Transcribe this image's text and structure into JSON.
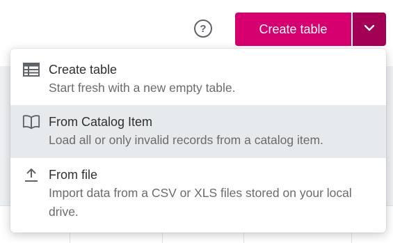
{
  "header": {
    "help_icon": "help-circle-icon",
    "create_button_label": "Create table",
    "caret_icon": "chevron-down-icon"
  },
  "colors": {
    "brand": "#d6006f",
    "brand_dark": "#a30055",
    "hover_bg": "#e6eaec"
  },
  "menu": {
    "items": [
      {
        "icon": "table-icon",
        "title": "Create table",
        "description": "Start fresh with a new empty table."
      },
      {
        "icon": "book-icon",
        "title": "From Catalog Item",
        "description": "Load all or only invalid records from a catalog item.",
        "highlighted": true
      },
      {
        "icon": "upload-icon",
        "title": "From file",
        "description": "Import data from a CSV or XLS files stored on your local drive."
      }
    ]
  }
}
